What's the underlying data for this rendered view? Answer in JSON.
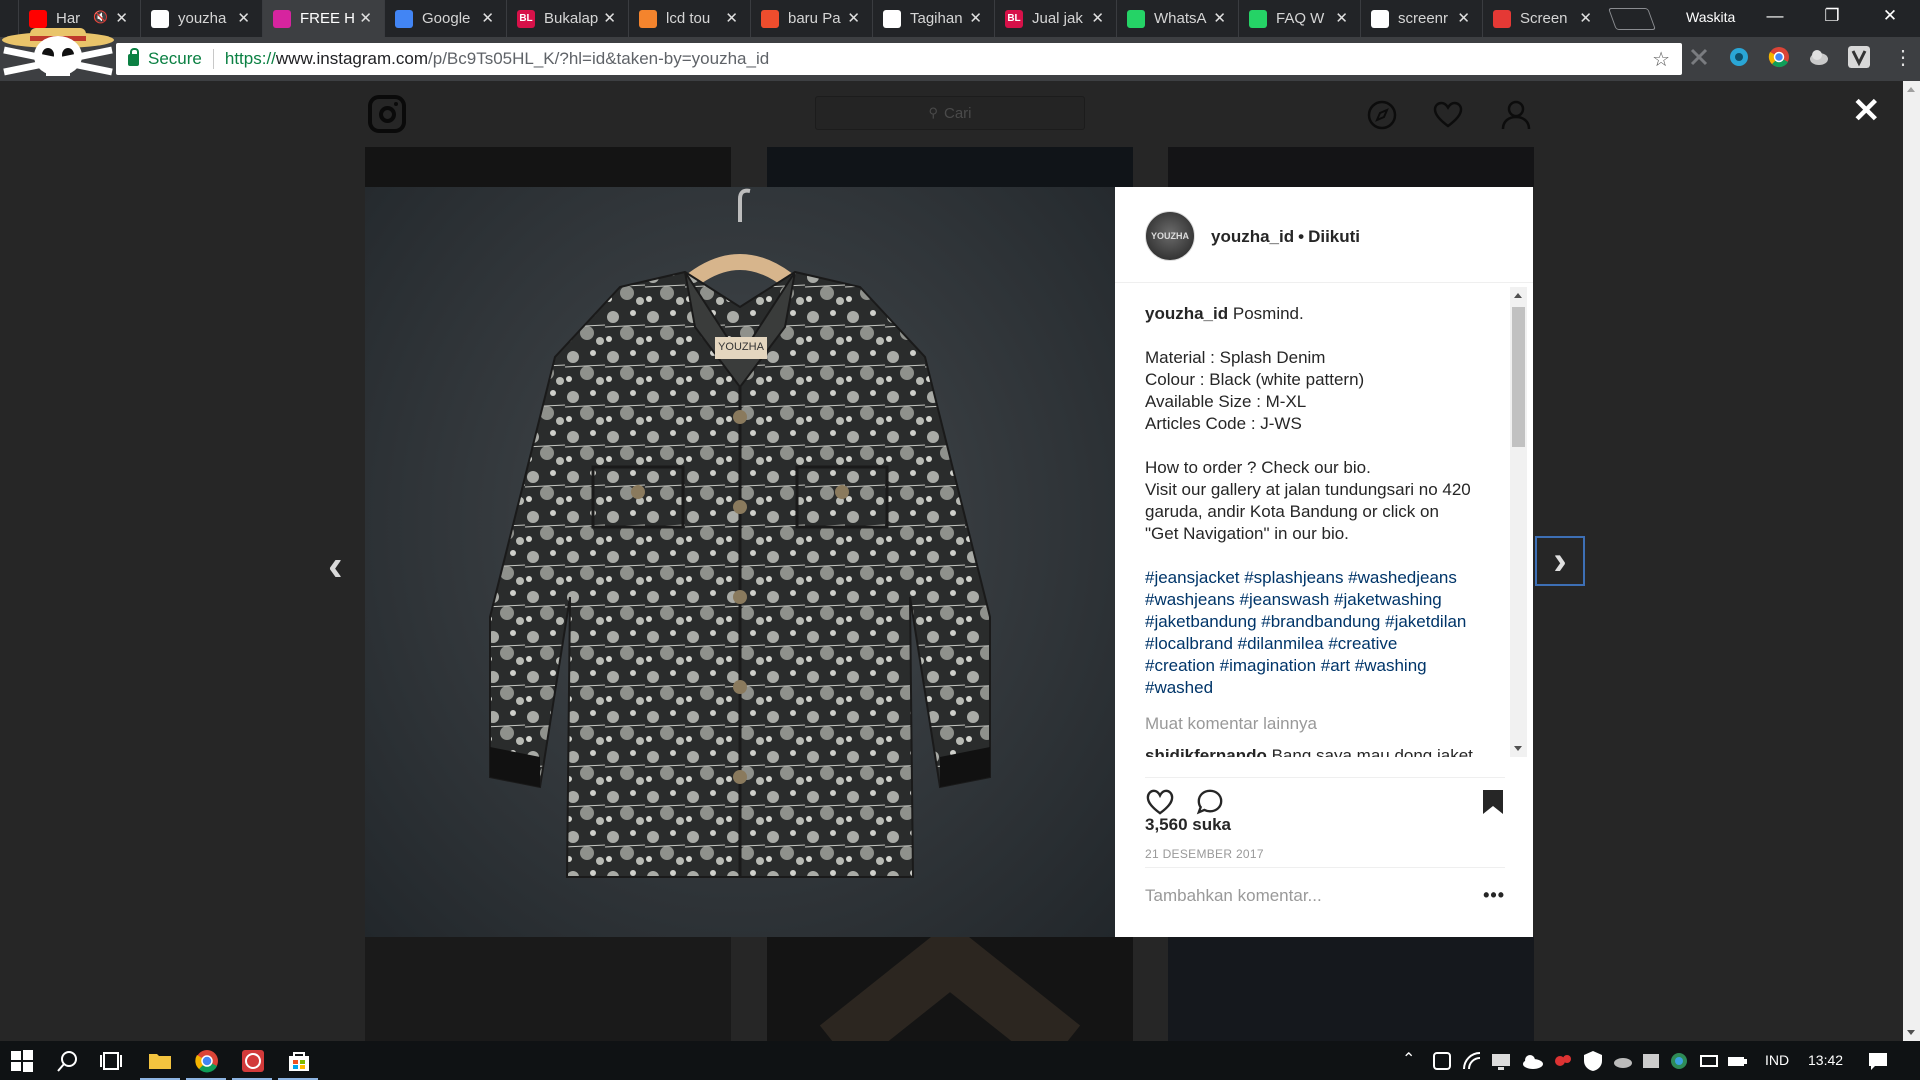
{
  "browser": {
    "tabs": [
      {
        "label": "Har",
        "favicon": "youtube-icon",
        "color": "#ff0000",
        "muted": true
      },
      {
        "label": "youzha",
        "favicon": "google-icon",
        "color": "#ffffff"
      },
      {
        "label": "FREE H",
        "favicon": "instagram-icon",
        "color": "#d6249f",
        "active": true
      },
      {
        "label": "Google",
        "favicon": "google-translate-icon",
        "color": "#4285f4"
      },
      {
        "label": "Bukalap",
        "favicon": "bukalapak-icon",
        "color": "#d71149",
        "glyph": "BL"
      },
      {
        "label": "lcd tou",
        "favicon": "feed-icon",
        "color": "#f4842d"
      },
      {
        "label": "baru Pa",
        "favicon": "shopee-icon",
        "color": "#ee4d2d"
      },
      {
        "label": "Tagihan",
        "favicon": "gmail-icon",
        "color": "#ffffff"
      },
      {
        "label": "Jual jak",
        "favicon": "bukalapak-icon",
        "color": "#d71149",
        "glyph": "BL"
      },
      {
        "label": "WhatsA",
        "favicon": "whatsapp-icon",
        "color": "#25d366"
      },
      {
        "label": "FAQ W",
        "favicon": "whatsapp-icon",
        "color": "#25d366"
      },
      {
        "label": "screenr",
        "favicon": "google-icon",
        "color": "#ffffff"
      },
      {
        "label": "Screen",
        "favicon": "screencast-icon",
        "color": "#e53935"
      }
    ],
    "profile_name": "Waskita",
    "secure_label": "Secure",
    "url": {
      "scheme": "https://",
      "host": "www.instagram.com",
      "path": "/p/Bc9Ts05HL_K/?hl=id&taken-by=youzha_id"
    }
  },
  "instagram": {
    "search_placeholder": "Cari",
    "post": {
      "username": "youzha_id",
      "follow_status": "Diikuti",
      "avatar_text": "YOUZHA",
      "caption_first": "Posmind.",
      "caption_lines": [
        "",
        "Material : Splash Denim",
        "Colour : Black (white pattern)",
        "Available Size : M-XL",
        "Articles Code : J-WS",
        "",
        "How to order ? Check our bio.",
        "Visit our gallery at jalan tundungsari no 420",
        "garuda, andir Kota Bandung or click on",
        "\"Get Navigation\" in our bio.",
        ""
      ],
      "hashtags_lines": [
        "#jeansjacket #splashjeans #washedjeans",
        "#washjeans #jeanswash #jaketwashing",
        "#jaketbandung #brandbandung #jaketdilan",
        "#localbrand #dilanmilea #creative",
        "#creation #imagination #art #washing",
        "#washed"
      ],
      "load_more_comments": "Muat komentar lainnya",
      "comment_user": "shidikfernando",
      "comment_text": "Bang saya mau dong jaket",
      "likes": "3,560 suka",
      "date": "21 DESEMBER 2017",
      "add_comment_placeholder": "Tambahkan komentar...",
      "more_options": "•••",
      "jacket_label": "YOUZHA"
    }
  },
  "taskbar": {
    "language": "IND",
    "time": "13:42"
  }
}
